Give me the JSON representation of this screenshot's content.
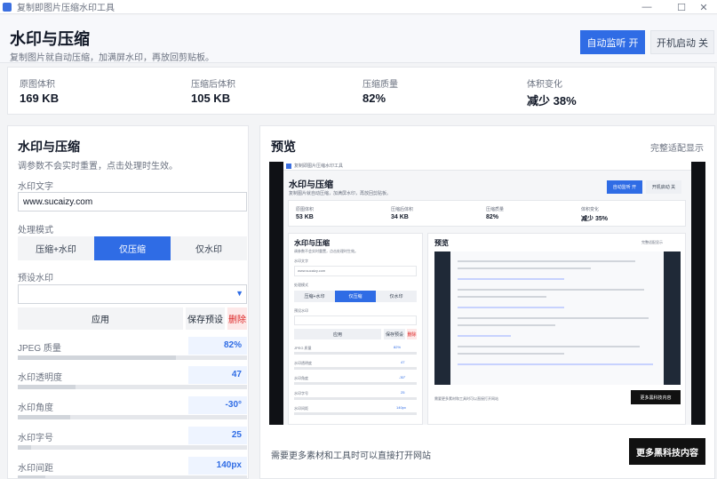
{
  "window": {
    "title": "复制即图片压缩水印工具",
    "controls": [
      "—",
      "☐",
      "✕"
    ]
  },
  "header": {
    "title": "水印与压缩",
    "subtitle": "复制图片就自动压缩，加满屏水印，再放回剪贴板。",
    "monitor_button": "自动监听 开",
    "autostart_button": "开机启动 关"
  },
  "stats": [
    {
      "label": "原图体积",
      "value": "169 KB"
    },
    {
      "label": "压缩后体积",
      "value": "105 KB"
    },
    {
      "label": "压缩质量",
      "value": "82%"
    },
    {
      "label": "体积变化",
      "value": "减少 38%"
    }
  ],
  "settings": {
    "title": "水印与压缩",
    "subtitle": "调参数不会实时重置，点击处理时生效。",
    "watermark_text_label": "水印文字",
    "watermark_text_value": "www.sucaizy.com",
    "mode_label": "处理模式",
    "modes": [
      "压缩+水印",
      "仅压缩",
      "仅水印"
    ],
    "active_mode": 1,
    "preset_label": "预设水印",
    "apply_button": "应用",
    "save_preset_button": "保存预设",
    "delete_button": "删除",
    "sliders": [
      {
        "label": "JPEG 质量",
        "value": "82%",
        "level": 0.69
      },
      {
        "label": "水印透明度",
        "value": "47",
        "level": 0.25
      },
      {
        "label": "水印角度",
        "value": "-30°",
        "level": 0.23
      },
      {
        "label": "水印字号",
        "value": "25",
        "level": 0.06
      },
      {
        "label": "水印间距",
        "value": "140px",
        "level": 0.12
      }
    ]
  },
  "preview": {
    "title": "预览",
    "fit_link": "完整适配显示",
    "footer_text": "需要更多素材和工具时可以直接打开网站",
    "more_button": "更多黑科技内容"
  },
  "mini_preview": {
    "window_title": "复制即图片压缩水印工具",
    "header_title": "水印与压缩",
    "header_subtitle": "复制图片就自动压缩，加满屏水印，再放回剪贴板。",
    "monitor_button": "自动监听 开",
    "autostart_button": "开机启动 关",
    "stats": [
      {
        "label": "原图体积",
        "value": "53 KB"
      },
      {
        "label": "压缩后体积",
        "value": "34 KB"
      },
      {
        "label": "压缩质量",
        "value": "82%"
      },
      {
        "label": "体积变化",
        "value": "减少 35%"
      }
    ],
    "settings_title": "水印与压缩",
    "settings_subtitle": "调参数不会实时重置，点击处理时生效。",
    "watermark_label": "水印文字",
    "watermark_value": "www.sucaizy.com",
    "mode_label": "处理模式",
    "modes": [
      "压缩+水印",
      "仅压缩",
      "仅水印"
    ],
    "preset_label": "预设水印",
    "apply": "应用",
    "save": "保存预设",
    "delete": "删除",
    "slider_labels": [
      "JPEG 质量",
      "水印透明度",
      "水印角度",
      "水印字号",
      "水印间距"
    ],
    "slider_values": [
      "82%",
      "47",
      "-30°",
      "25",
      "140px"
    ],
    "preview_title": "预览",
    "fit_link": "完整适配显示",
    "footer": "需要更多素材和工具时可以直接打开网站",
    "more_button": "更多黑科技内容"
  }
}
